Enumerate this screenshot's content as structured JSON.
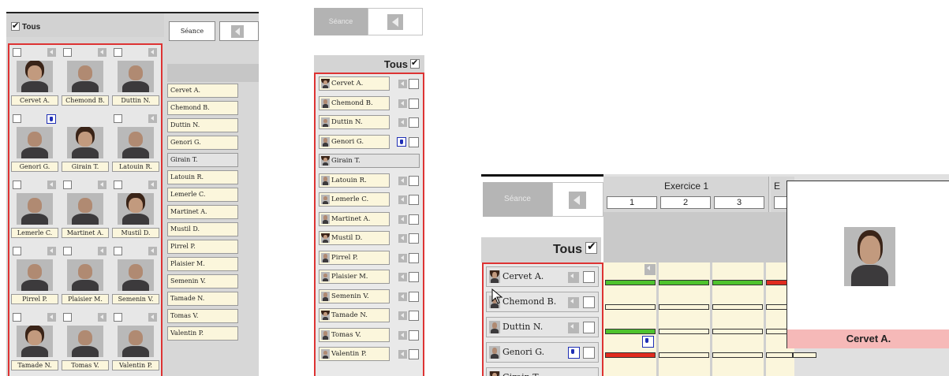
{
  "panel_grid": {
    "all_label": "Tous",
    "all_checked": true,
    "seance_label": "Séance",
    "students": [
      {
        "name": "Cervet A.",
        "status": "mini"
      },
      {
        "name": "Chemond B.",
        "status": "mini"
      },
      {
        "name": "Duttin N.",
        "status": "mini"
      },
      {
        "name": "Genori G.",
        "status": "hand"
      },
      {
        "name": "Girain T.",
        "status": "none"
      },
      {
        "name": "Latouin R.",
        "status": "mini"
      },
      {
        "name": "Lemerle C.",
        "status": "mini"
      },
      {
        "name": "Martinet A.",
        "status": "mini"
      },
      {
        "name": "Mustil D.",
        "status": "mini"
      },
      {
        "name": "Pirrel P.",
        "status": "mini"
      },
      {
        "name": "Plaisier M.",
        "status": "mini"
      },
      {
        "name": "Semenin V.",
        "status": "mini"
      },
      {
        "name": "Tamade N.",
        "status": "mini"
      },
      {
        "name": "Tomas V.",
        "status": "mini"
      },
      {
        "name": "Valentin P.",
        "status": "mini"
      }
    ],
    "right_list": [
      "Cervet A.",
      "Chemond B.",
      "Duttin N.",
      "Genori G.",
      "Girain T.",
      "Latouin R.",
      "Lemerle C.",
      "Martinet A.",
      "Mustil D.",
      "Pirrel P.",
      "Plaisier M.",
      "Semenin V.",
      "Tamade N.",
      "Tomas V.",
      "Valentin P."
    ]
  },
  "panel_list": {
    "seance_label": "Séance",
    "all_label": "Tous",
    "all_checked": true,
    "students": [
      {
        "name": "Cervet A.",
        "status": "mini"
      },
      {
        "name": "Chemond B.",
        "status": "mini"
      },
      {
        "name": "Duttin N.",
        "status": "mini"
      },
      {
        "name": "Genori G.",
        "status": "hand"
      },
      {
        "name": "Girain T.",
        "status": "none"
      },
      {
        "name": "Latouin R.",
        "status": "mini"
      },
      {
        "name": "Lemerle C.",
        "status": "mini"
      },
      {
        "name": "Martinet A.",
        "status": "mini"
      },
      {
        "name": "Mustil D.",
        "status": "mini"
      },
      {
        "name": "Pirrel P.",
        "status": "mini"
      },
      {
        "name": "Plaisier M.",
        "status": "mini"
      },
      {
        "name": "Semenin V.",
        "status": "mini"
      },
      {
        "name": "Tamade N.",
        "status": "mini"
      },
      {
        "name": "Tomas V.",
        "status": "mini"
      },
      {
        "name": "Valentin P.",
        "status": "mini"
      }
    ]
  },
  "panel_session": {
    "seance_label": "Séance",
    "all_label": "Tous",
    "all_checked": true,
    "exercise_title": "Exercice 1",
    "exercise_numbers": [
      "1",
      "2",
      "3"
    ],
    "next_exercise_initial": "E",
    "students": [
      {
        "name": "Cervet A.",
        "status": "mini"
      },
      {
        "name": "Chemond B.",
        "status": "mini"
      },
      {
        "name": "Duttin N.",
        "status": "mini"
      },
      {
        "name": "Genori G.",
        "status": "hand"
      },
      {
        "name": "Girain T.",
        "status": "none"
      }
    ],
    "popup_name": "Cervet A.",
    "colors": {
      "success": "#4ec32d",
      "failure": "#e02b1f",
      "highlight": "#f6b9b8",
      "selection_border": "#dd3333"
    }
  }
}
